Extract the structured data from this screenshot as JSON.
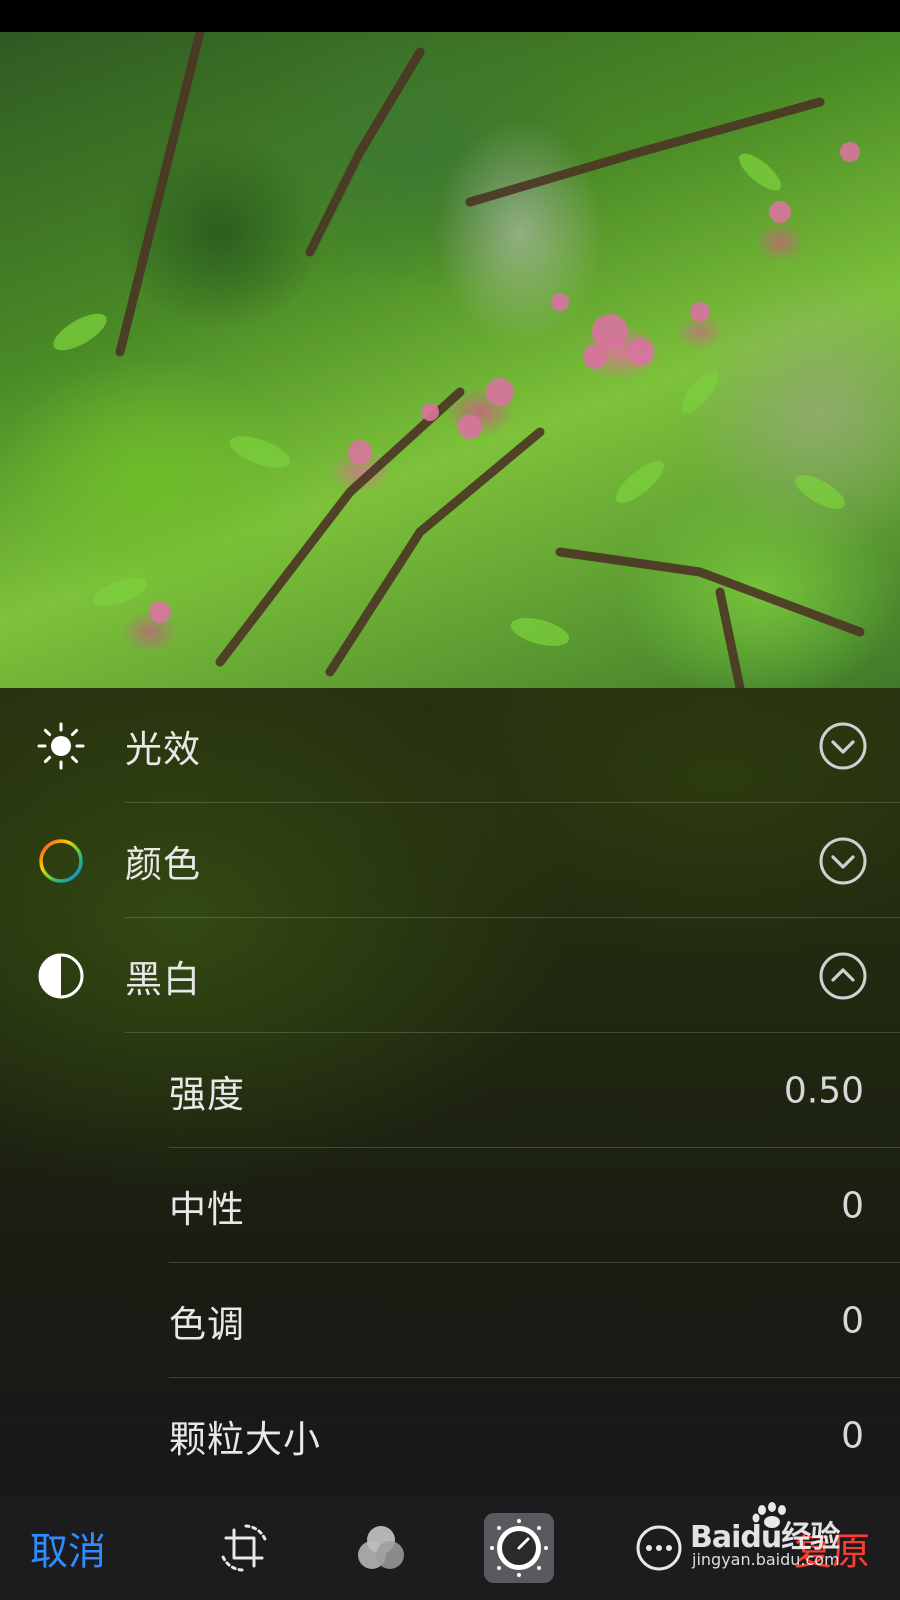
{
  "editor": {
    "sections": [
      {
        "label": "光效",
        "icon": "sun-icon",
        "state": "collapsed"
      },
      {
        "label": "颜色",
        "icon": "color-wheel-icon",
        "state": "collapsed"
      },
      {
        "label": "黑白",
        "icon": "half-circle-icon",
        "state": "expanded"
      }
    ],
    "bw_controls": [
      {
        "label": "强度",
        "value": "0.50"
      },
      {
        "label": "中性",
        "value": "0"
      },
      {
        "label": "色调",
        "value": "0"
      },
      {
        "label": "颗粒大小",
        "value": "0"
      }
    ]
  },
  "toolbar": {
    "cancel_label": "取消",
    "restore_label": "复原",
    "tools": [
      "crop-rotate-icon",
      "filters-icon",
      "adjust-dial-icon",
      "more-options-icon"
    ],
    "active_tool": "adjust-dial-icon"
  },
  "watermark": {
    "brand": "Baidu经验",
    "url": "jingyan.baidu.com"
  },
  "colors": {
    "accent": "#2f8cff",
    "destructive": "#ff3b30",
    "toolbar_bg": "#1c1c1e"
  }
}
